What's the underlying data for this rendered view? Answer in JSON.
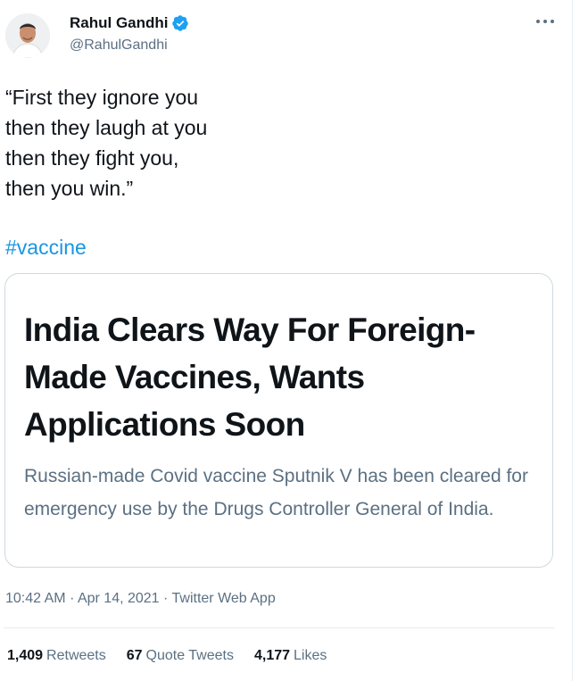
{
  "author": {
    "display_name": "Rahul Gandhi",
    "handle": "@RahulGandhi",
    "verified_icon": "verified-badge-icon",
    "verified_color": "#1da1f2"
  },
  "menu_icon": "more-options-icon",
  "tweet": {
    "text": "“First they ignore you\nthen they laugh at you\nthen they fight you,\nthen you win.”",
    "hashtag": "#vaccine"
  },
  "card": {
    "headline": "India Clears Way For Foreign-Made Vaccines, Wants Applications Soon",
    "description": "Russian-made Covid vaccine Sputnik V has been cleared for emergency use by the Drugs Controller General of India."
  },
  "meta": {
    "time": "10:42 AM",
    "separator": "·",
    "date": "Apr 14, 2021",
    "source": "Twitter Web App"
  },
  "stats": {
    "retweets_count": "1,409",
    "retweets_label": "Retweets",
    "quotes_count": "67",
    "quotes_label": "Quote Tweets",
    "likes_count": "4,177",
    "likes_label": "Likes"
  },
  "colors": {
    "link": "#1b95e0",
    "secondary_text": "#5b7083",
    "primary_text": "#0f1419",
    "border": "#cfd9de"
  }
}
